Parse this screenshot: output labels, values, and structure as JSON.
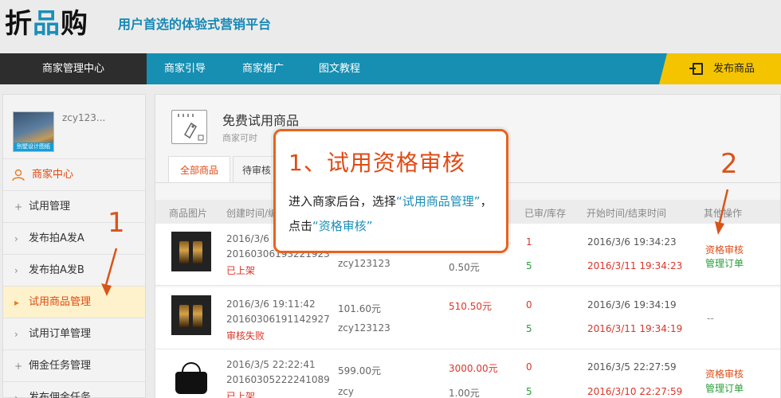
{
  "header": {
    "logo_part1": "折",
    "logo_part2": "品",
    "logo_part3": "购",
    "slogan": "用户首选的体验式营销平台"
  },
  "nav": {
    "items": [
      {
        "label": "商家管理中心",
        "active": true
      },
      {
        "label": "商家引导"
      },
      {
        "label": "商家推广"
      },
      {
        "label": "图文教程"
      }
    ],
    "publish_label": "发布商品"
  },
  "sidebar": {
    "avatar_caption": "别墅设计图纸",
    "username": "zcy123...",
    "center_label": "商家中心",
    "items": [
      {
        "label": "试用管理",
        "type": "group"
      },
      {
        "label": "发布拍A发A",
        "type": "sub"
      },
      {
        "label": "发布拍A发B",
        "type": "sub"
      },
      {
        "label": "试用商品管理",
        "type": "sub",
        "active": true
      },
      {
        "label": "试用订单管理",
        "type": "sub"
      },
      {
        "label": "佣金任务管理",
        "type": "group"
      },
      {
        "label": "发布佣金任务",
        "type": "sub"
      }
    ]
  },
  "panel": {
    "title": "免费试用商品",
    "subtitle": "商家可时",
    "tabs": [
      {
        "label": "全部商品",
        "active": true
      },
      {
        "label": "待审核"
      }
    ],
    "columns": {
      "image": "商品图片",
      "created": "创建时间/编",
      "done_stock": "已审/库存",
      "time": "开始时间/结束时间",
      "ops": "其他操作"
    },
    "rows": [
      {
        "date": "2016/3/6",
        "id": "20160306193221923",
        "status": "已上架",
        "price": "",
        "seller": "zcy123123",
        "total": "",
        "unit": "0.50元",
        "done": "1",
        "stock": "5",
        "start": "2016/3/6 19:34:23",
        "end": "2016/3/11 19:34:23",
        "op1": "资格审核",
        "op2": "管理订单"
      },
      {
        "date": "2016/3/6 19:11:42",
        "id": "20160306191142927",
        "status": "审核失败",
        "price": "101.60元",
        "seller": "zcy123123",
        "total": "510.50元",
        "unit": "",
        "done": "0",
        "stock": "5",
        "start": "2016/3/6 19:34:19",
        "end": "2016/3/11 19:34:19",
        "op1": "",
        "op2": "",
        "dash": "--"
      },
      {
        "date": "2016/3/5 22:22:41",
        "id": "20160305222241089",
        "status": "已上架",
        "price": "599.00元",
        "seller": "zcy",
        "total": "3000.00元",
        "unit": "1.00元",
        "done": "0",
        "stock": "5",
        "start": "2016/3/5 22:27:59",
        "end": "2016/3/10 22:27:59",
        "op1": "资格审核",
        "op2": "管理订单"
      }
    ]
  },
  "callout": {
    "title": "1、试用资格审核",
    "body_1": "进入商家后台，选择",
    "body_hl1": "“试用商品管理”",
    "body_2": "，点击",
    "body_hl2": "“资格审核”"
  },
  "steps": {
    "step1": "1",
    "step2": "2"
  },
  "colors": {
    "brand_blue": "#168fb3",
    "accent_orange": "#e04a14",
    "publish_yellow": "#f4c400",
    "nav_dark": "#2d2d2d"
  }
}
